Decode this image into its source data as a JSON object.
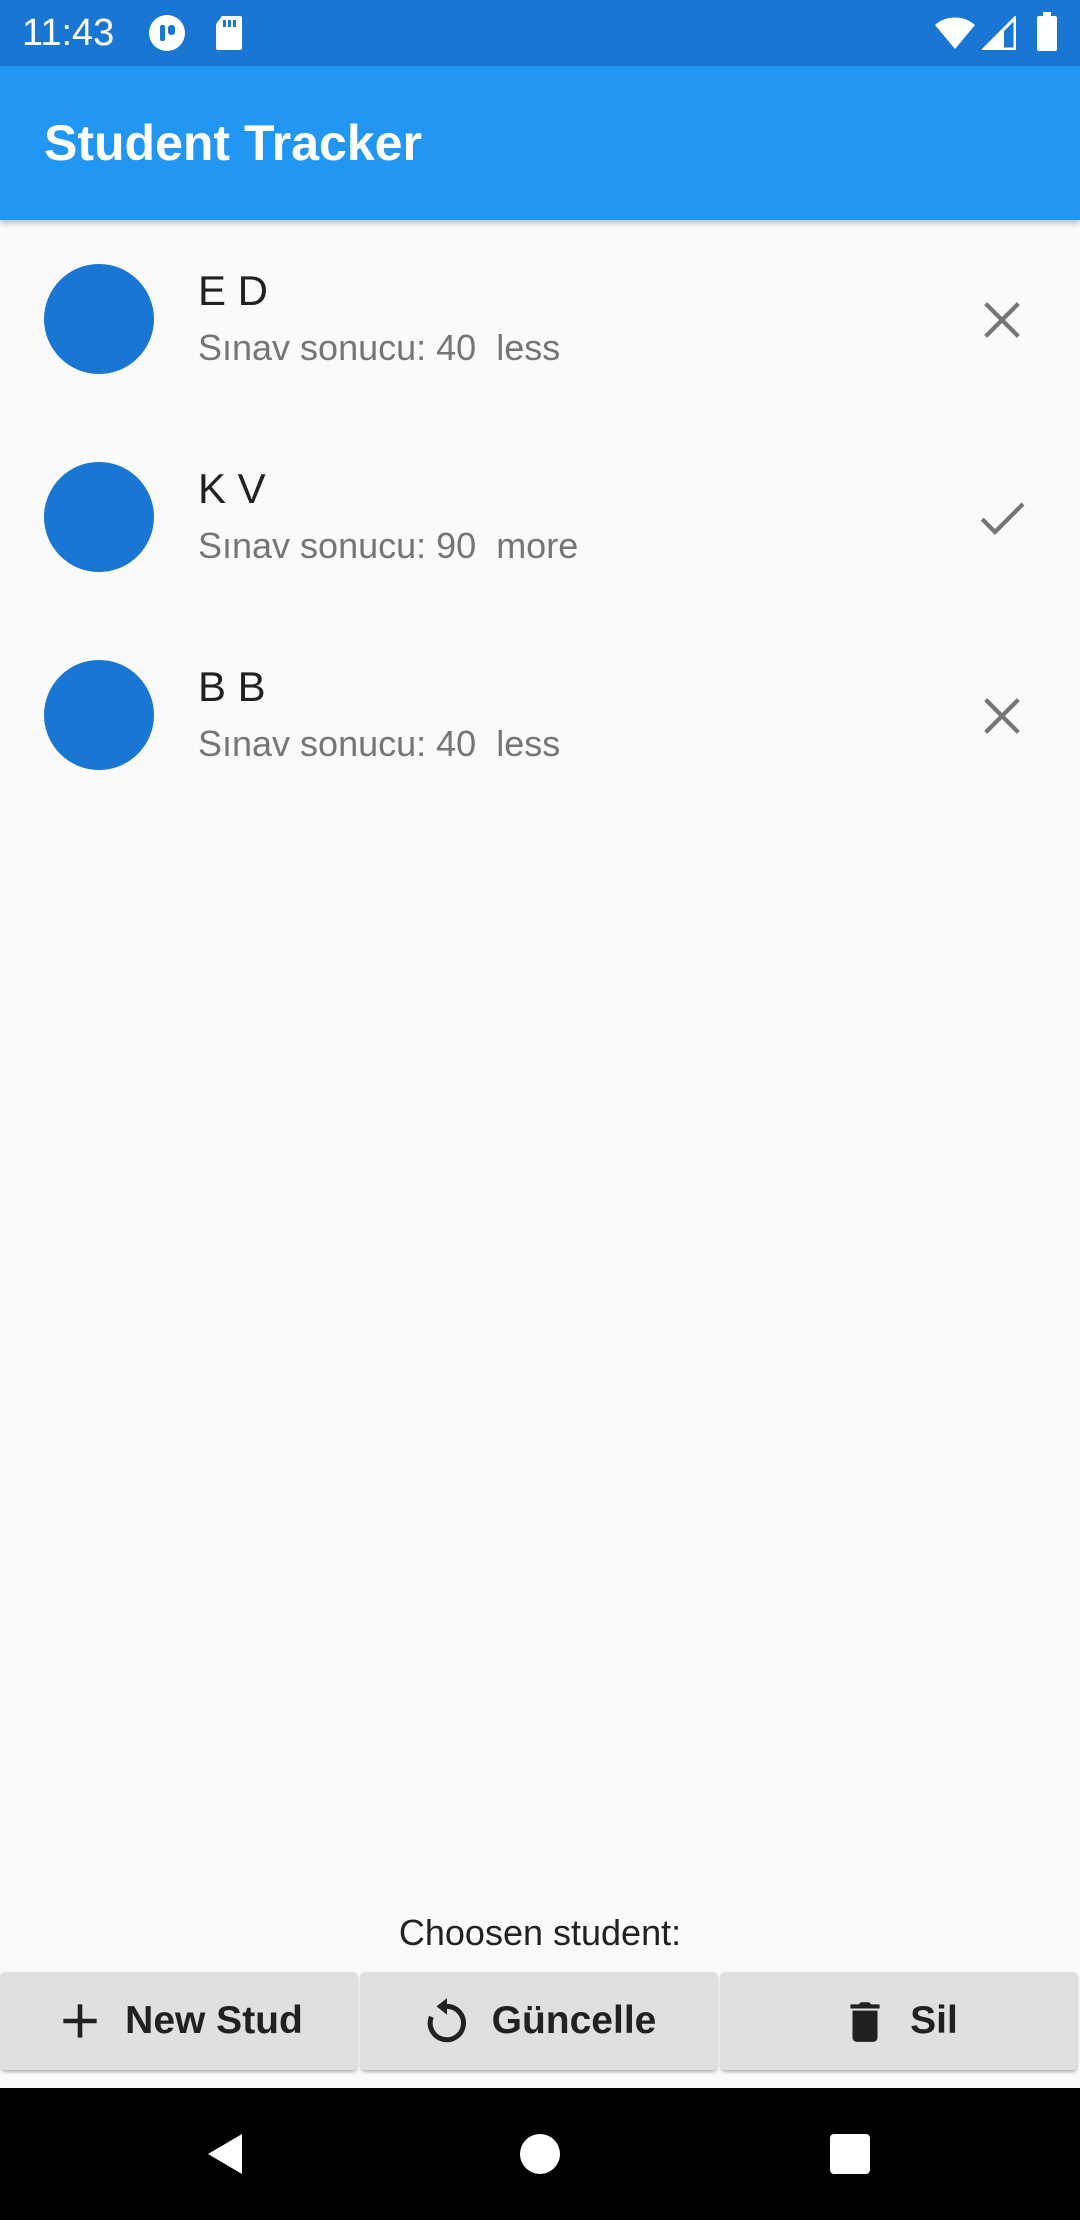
{
  "status_bar": {
    "time": "11:43",
    "icons": [
      "notification-app-icon",
      "sd-card-icon",
      "wifi-icon",
      "signal-icon",
      "battery-icon"
    ]
  },
  "app_bar": {
    "title": "Student Tracker",
    "background_color": "#2196f3"
  },
  "students": [
    {
      "name": "E D",
      "subtitle": "Sınav sonucu: 40  less",
      "status_icon": "close-icon"
    },
    {
      "name": "K V",
      "subtitle": "Sınav sonucu: 90  more",
      "status_icon": "check-icon"
    },
    {
      "name": "B B",
      "subtitle": "Sınav sonucu: 40  less",
      "status_icon": "close-icon"
    }
  ],
  "chosen_label": "Choosen student:",
  "buttons": {
    "new": {
      "label": "New Stud",
      "icon": "add-icon"
    },
    "update": {
      "label": "Güncelle",
      "icon": "refresh-icon"
    },
    "delete": {
      "label": "Sil",
      "icon": "trash-icon"
    }
  },
  "nav_bar": {
    "icons": [
      "back-icon",
      "home-icon",
      "recents-icon"
    ]
  },
  "colors": {
    "status_bar": "#1976d2",
    "avatar": "#1976d2",
    "button_bg": "#e0e0e0"
  }
}
